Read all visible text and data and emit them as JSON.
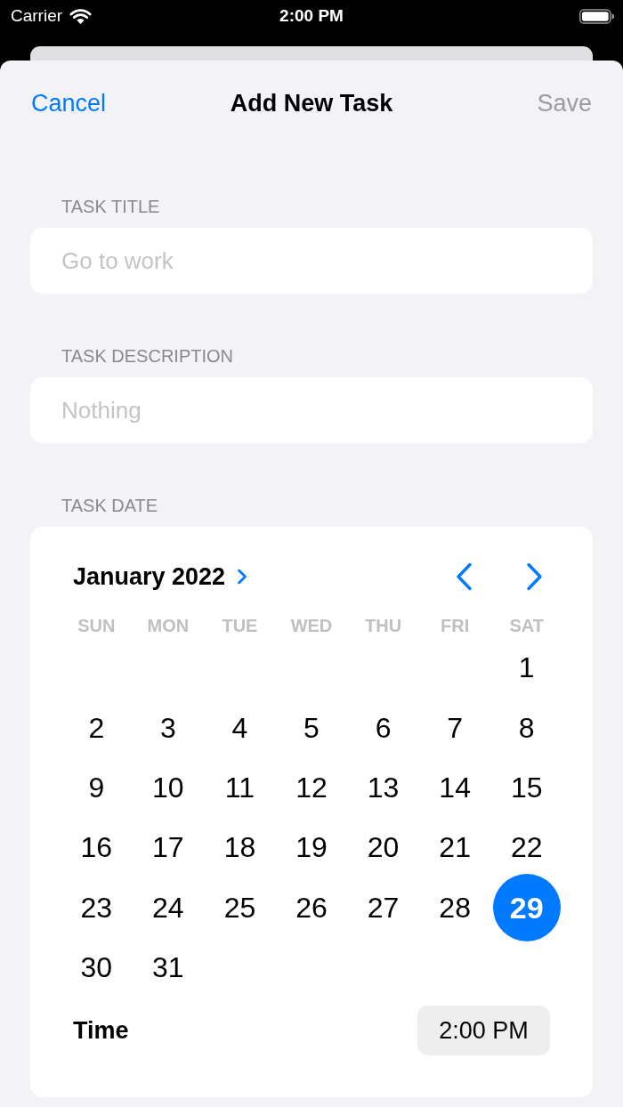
{
  "status_bar": {
    "carrier": "Carrier",
    "time": "2:00 PM"
  },
  "nav": {
    "cancel": "Cancel",
    "title": "Add New Task",
    "save": {
      "label": "Save",
      "disabled": true
    }
  },
  "fields": [
    {
      "label": "TASK TITLE",
      "placeholder": "Go to work"
    },
    {
      "label": "TASK DESCRIPTION",
      "placeholder": "Nothing"
    }
  ],
  "date_section": {
    "label": "TASK DATE",
    "calendar": {
      "month": "January 2022",
      "weekdays": [
        "SUN",
        "MON",
        "TUE",
        "WED",
        "THU",
        "FRI",
        "SAT"
      ],
      "weeks": [
        [
          {
            "day": "1",
            "selected": false
          }
        ],
        [
          {
            "day": "2",
            "selected": false
          },
          {
            "day": "3",
            "selected": false
          },
          {
            "day": "4",
            "selected": false
          },
          {
            "day": "5",
            "selected": false
          },
          {
            "day": "6",
            "selected": false
          },
          {
            "day": "7",
            "selected": false
          },
          {
            "day": "8",
            "selected": false
          }
        ],
        [
          {
            "day": "9",
            "selected": false
          },
          {
            "day": "10",
            "selected": false
          },
          {
            "day": "11",
            "selected": false
          },
          {
            "day": "12",
            "selected": false
          },
          {
            "day": "13",
            "selected": false
          },
          {
            "day": "14",
            "selected": false
          },
          {
            "day": "15",
            "selected": false
          }
        ],
        [
          {
            "day": "16",
            "selected": false
          },
          {
            "day": "17",
            "selected": false
          },
          {
            "day": "18",
            "selected": false
          },
          {
            "day": "19",
            "selected": false
          },
          {
            "day": "20",
            "selected": false
          },
          {
            "day": "21",
            "selected": false
          },
          {
            "day": "22",
            "selected": false
          }
        ],
        [
          {
            "day": "23",
            "selected": false
          },
          {
            "day": "24",
            "selected": false
          },
          {
            "day": "25",
            "selected": false
          },
          {
            "day": "26",
            "selected": false
          },
          {
            "day": "27",
            "selected": false
          },
          {
            "day": "28",
            "selected": false
          },
          {
            "day": "29",
            "selected": true
          }
        ],
        [
          {
            "day": "30",
            "selected": false
          },
          {
            "day": "31",
            "selected": false
          }
        ]
      ]
    },
    "time": {
      "label": "Time",
      "value": "2:00 PM"
    }
  }
}
